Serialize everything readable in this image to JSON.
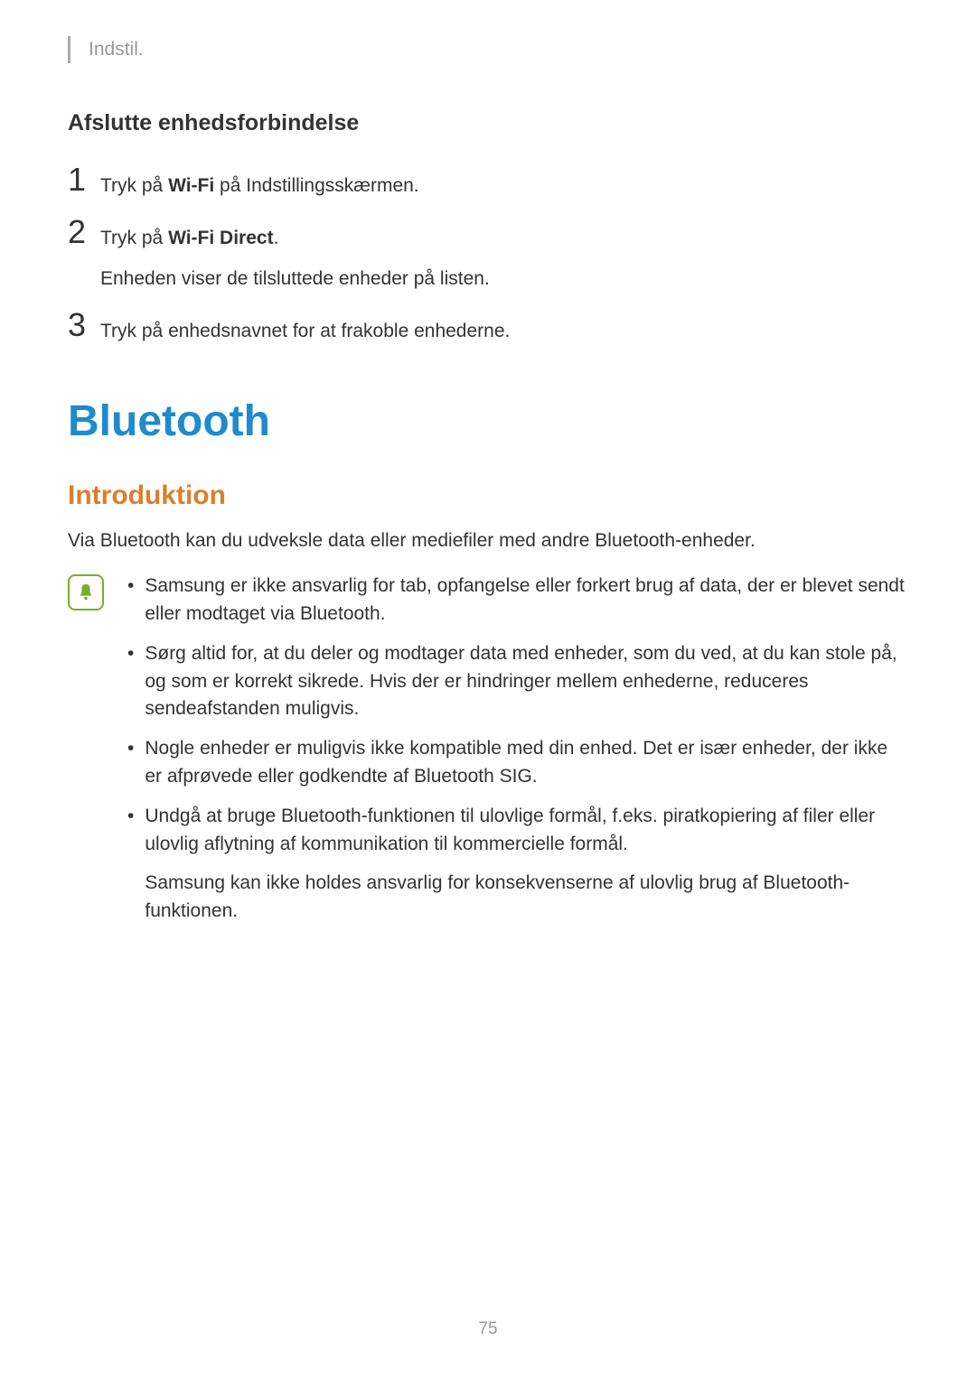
{
  "breadcrumb": "Indstil.",
  "subtitle": "Afslutte enhedsforbindelse",
  "steps": [
    {
      "number": "1",
      "prefix": "Tryk på ",
      "bold": "Wi-Fi",
      "suffix": " på Indstillingsskærmen.",
      "subtext": ""
    },
    {
      "number": "2",
      "prefix": "Tryk på ",
      "bold": "Wi-Fi Direct",
      "suffix": ".",
      "subtext": "Enheden viser de tilsluttede enheder på listen."
    },
    {
      "number": "3",
      "prefix": "Tryk på enhedsnavnet for at frakoble enhederne.",
      "bold": "",
      "suffix": "",
      "subtext": ""
    }
  ],
  "mainTitle": "Bluetooth",
  "sectionTitle": "Introduktion",
  "introText": "Via Bluetooth kan du udveksle data eller mediefiler med andre Bluetooth-enheder.",
  "notes": [
    {
      "text": "Samsung er ikke ansvarlig for tab, opfangelse eller forkert brug af data, der er blevet sendt eller modtaget via Bluetooth.",
      "extra": ""
    },
    {
      "text": "Sørg altid for, at du deler og modtager data med enheder, som du ved, at du kan stole på, og som er korrekt sikrede. Hvis der er hindringer mellem enhederne, reduceres sendeafstanden muligvis.",
      "extra": ""
    },
    {
      "text": "Nogle enheder er muligvis ikke kompatible med din enhed. Det er især enheder, der ikke er afprøvede eller godkendte af Bluetooth SIG.",
      "extra": ""
    },
    {
      "text": "Undgå at bruge Bluetooth-funktionen til ulovlige formål, f.eks. piratkopiering af filer eller ulovlig aflytning af kommunikation til kommercielle formål.",
      "extra": "Samsung kan ikke holdes ansvarlig for konsekvenserne af ulovlig brug af Bluetooth-funktionen."
    }
  ],
  "pageNumber": "75"
}
